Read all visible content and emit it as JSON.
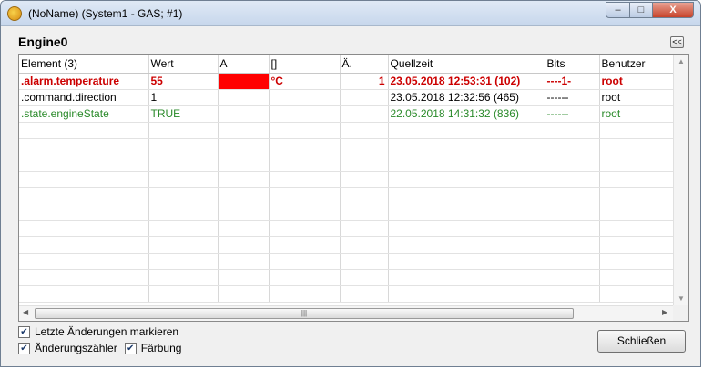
{
  "window": {
    "title": "(NoName) (System1 - GAS; #1)",
    "controls": {
      "minimize": "–",
      "maximize": "□",
      "close": "X"
    }
  },
  "panel": {
    "heading": "Engine0",
    "collapse_label": "<<"
  },
  "table": {
    "columns": [
      "Element (3)",
      "Wert",
      "A",
      "[]",
      "Ä.",
      "Quellzeit",
      "Bits",
      "Benutzer"
    ],
    "rows": [
      {
        "state": "alarm",
        "color": "#cc0000",
        "bold": true,
        "cells": [
          ".alarm.temperature",
          "55",
          "",
          "°C",
          "1",
          "23.05.2018  12:53:31 (102)",
          "----1-",
          "root"
        ],
        "alarm_fill": "#ff0000"
      },
      {
        "state": "normal",
        "color": "#000000",
        "bold": false,
        "cells": [
          ".command.direction",
          "1",
          "",
          "",
          "",
          "23.05.2018  12:32:56 (465)",
          "------",
          "root"
        ]
      },
      {
        "state": "ok",
        "color": "#2a8a2a",
        "bold": false,
        "cells": [
          ".state.engineState",
          "TRUE",
          "",
          "",
          "",
          "22.05.2018  14:31:32 (836)",
          "------",
          "root"
        ]
      }
    ],
    "empty_rows": 11
  },
  "scrollbars": {
    "up_arrow": "▲",
    "down_arrow": "▼",
    "left_arrow": "◀",
    "right_arrow": "▶",
    "thumb_grip": "|||"
  },
  "options": {
    "mark_changes": {
      "label": "Letzte Änderungen markieren",
      "checked": true
    },
    "change_counter": {
      "label": "Änderungszähler",
      "checked": true
    },
    "coloring": {
      "label": "Färbung",
      "checked": true
    }
  },
  "buttons": {
    "close_label": "Schließen"
  }
}
